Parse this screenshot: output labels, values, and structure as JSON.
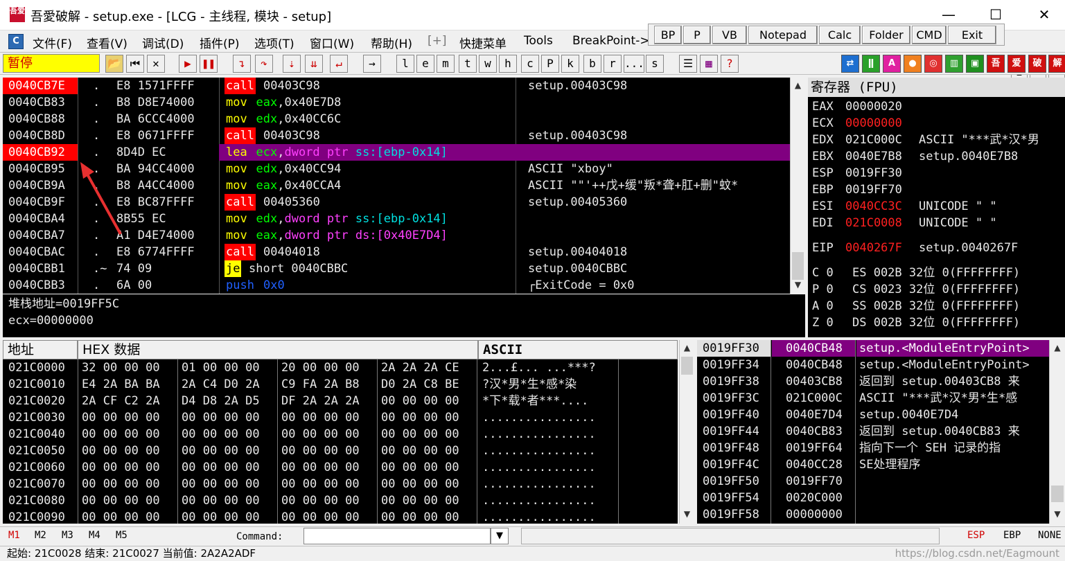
{
  "window": {
    "title": "吾愛破解 - setup.exe - [LCG - 主线程, 模块 - setup]",
    "icon": "吾爱",
    "minimize": "—",
    "maximize": "☐",
    "close": "✕"
  },
  "menu": {
    "items": [
      "文件(F)",
      "查看(V)",
      "调试(D)",
      "插件(P)",
      "选项(T)",
      "窗口(W)",
      "帮助(H)",
      "[+]",
      "快捷菜单",
      "Tools",
      "BreakPoint->"
    ]
  },
  "plugin_bar": {
    "buttons": [
      "BP",
      "P",
      "VB",
      "Notepad",
      "Calc",
      "Folder",
      "CMD",
      "Exit"
    ]
  },
  "toolbar": {
    "status": "暂停",
    "letters": [
      "l",
      "e",
      "m",
      "t",
      "w",
      "h",
      "c",
      "P",
      "k",
      "b",
      "r",
      "...",
      "s"
    ]
  },
  "disasm": {
    "rows": [
      {
        "addr": "0040CB7E",
        "mark": ".",
        "hex": "E8 1571FFFF",
        "op": "call",
        "args": "00403C98",
        "comment": "setup.00403C98",
        "addr_hl": true
      },
      {
        "addr": "0040CB83",
        "mark": ".",
        "hex": "B8 D8E74000",
        "op": "mov",
        "args": "eax,0x40E7D8",
        "comment": ""
      },
      {
        "addr": "0040CB88",
        "mark": ".",
        "hex": "BA 6CCC4000",
        "op": "mov",
        "args": "edx,0x40CC6C",
        "comment": ""
      },
      {
        "addr": "0040CB8D",
        "mark": ".",
        "hex": "E8 0671FFFF",
        "op": "call",
        "args": "00403C98",
        "comment": "setup.00403C98"
      },
      {
        "addr": "0040CB92",
        "mark": ".",
        "hex": "8D4D EC",
        "op": "lea",
        "args": "ecx,dword ptr ss:[ebp-0x14]",
        "comment": "",
        "addr_hl": true,
        "row_hl": true
      },
      {
        "addr": "0040CB95",
        "mark": ".",
        "hex": "BA 94CC4000",
        "op": "mov",
        "args": "edx,0x40CC94",
        "comment": "ASCII \"xboy\""
      },
      {
        "addr": "0040CB9A",
        "mark": ".",
        "hex": "B8 A4CC4000",
        "op": "mov",
        "args": "eax,0x40CCA4",
        "comment": "ASCII \"\"'++戊+缓\"叛*聋+肛+删\"蚊*"
      },
      {
        "addr": "0040CB9F",
        "mark": ".",
        "hex": "E8 BC87FFFF",
        "op": "call",
        "args": "00405360",
        "comment": "setup.00405360"
      },
      {
        "addr": "0040CBA4",
        "mark": ".",
        "hex": "8B55 EC",
        "op": "mov",
        "args": "edx,dword ptr ss:[ebp-0x14]",
        "comment": ""
      },
      {
        "addr": "0040CBA7",
        "mark": ".",
        "hex": "A1 D4E74000",
        "op": "mov",
        "args": "eax,dword ptr ds:[0x40E7D4]",
        "comment": ""
      },
      {
        "addr": "0040CBAC",
        "mark": ".",
        "hex": "E8 6774FFFF",
        "op": "call",
        "args": "00404018",
        "comment": "setup.00404018"
      },
      {
        "addr": "0040CBB1",
        "mark": ".~",
        "hex": "74 09",
        "op": "je",
        "args": "short 0040CBBC",
        "comment": "setup.0040CBBC"
      },
      {
        "addr": "0040CBB3",
        "mark": ".",
        "hex": "6A 00",
        "op": "push",
        "args": "0x0",
        "comment": "┌ExitCode = 0x0"
      }
    ]
  },
  "info": {
    "line1": "堆栈地址=0019FF5C",
    "line2": "ecx=00000000"
  },
  "registers": {
    "title": "寄存器 (FPU)",
    "rows": [
      {
        "name": "EAX",
        "value": "00000020",
        "desc": "",
        "red": false
      },
      {
        "name": "ECX",
        "value": "00000000",
        "desc": "",
        "red": true
      },
      {
        "name": "EDX",
        "value": "021C000C",
        "desc": "ASCII \"***武*汉*男",
        "red": false
      },
      {
        "name": "EBX",
        "value": "0040E7B8",
        "desc": "setup.0040E7B8",
        "red": false
      },
      {
        "name": "ESP",
        "value": "0019FF30",
        "desc": "",
        "red": false
      },
      {
        "name": "EBP",
        "value": "0019FF70",
        "desc": "",
        "red": false
      },
      {
        "name": "ESI",
        "value": "0040CC3C",
        "desc": "UNICODE \" \"",
        "red": true
      },
      {
        "name": "EDI",
        "value": "021C0008",
        "desc": "UNICODE \" \"",
        "red": true
      }
    ],
    "eip": {
      "name": "EIP",
      "value": "0040267F",
      "desc": "setup.0040267F"
    },
    "flags": [
      {
        "f": "C 0",
        "seg": "ES 002B 32位 0(FFFFFFFF)"
      },
      {
        "f": "P 0",
        "seg": "CS 0023 32位 0(FFFFFFFF)"
      },
      {
        "f": "A 0",
        "seg": "SS 002B 32位 0(FFFFFFFF)"
      },
      {
        "f": "Z 0",
        "seg": "DS 002B 32位 0(FFFFFFFF)"
      }
    ]
  },
  "dump": {
    "addr_header": "地址",
    "hex_header": "HEX 数据",
    "ascii_header": "ASCII",
    "rows": [
      {
        "addr": "021C0000",
        "hex": "32 00 00 00 01 00 00 00 20 00 00 00 2A 2A 2A CE",
        "ascii": "2...£... ...***?"
      },
      {
        "addr": "021C0010",
        "hex": "E4 2A BA BA 2A C4 D0 2A C9 FA 2A B8 D0 2A C8 BE",
        "ascii": "?汉*男*生*感*染"
      },
      {
        "addr": "021C0020",
        "hex": "2A CF C2 2A D4 D8 2A D5 DF 2A 2A 2A 00 00 00 00",
        "ascii": "*下*载*者***...."
      },
      {
        "addr": "021C0030",
        "hex": "00 00 00 00 00 00 00 00 00 00 00 00 00 00 00 00",
        "ascii": "................"
      },
      {
        "addr": "021C0040",
        "hex": "00 00 00 00 00 00 00 00 00 00 00 00 00 00 00 00",
        "ascii": "................"
      },
      {
        "addr": "021C0050",
        "hex": "00 00 00 00 00 00 00 00 00 00 00 00 00 00 00 00",
        "ascii": "................"
      },
      {
        "addr": "021C0060",
        "hex": "00 00 00 00 00 00 00 00 00 00 00 00 00 00 00 00",
        "ascii": "................"
      },
      {
        "addr": "021C0070",
        "hex": "00 00 00 00 00 00 00 00 00 00 00 00 00 00 00 00",
        "ascii": "................"
      },
      {
        "addr": "021C0080",
        "hex": "00 00 00 00 00 00 00 00 00 00 00 00 00 00 00 00",
        "ascii": "................"
      },
      {
        "addr": "021C0090",
        "hex": "00 00 00 00 00 00 00 00 00 00 00 00 00 00 00 00",
        "ascii": "................"
      }
    ]
  },
  "stack": {
    "rows": [
      {
        "addr": "0019FF30",
        "val": "0040CB48",
        "comment": "setup.<ModuleEntryPoint>",
        "hl": true
      },
      {
        "addr": "0019FF34",
        "val": "0040CB48",
        "comment": "setup.<ModuleEntryPoint>"
      },
      {
        "addr": "0019FF38",
        "val": "00403CB8",
        "comment": "返回到 setup.00403CB8 来"
      },
      {
        "addr": "0019FF3C",
        "val": "021C000C",
        "comment": "ASCII \"***武*汉*男*生*感"
      },
      {
        "addr": "0019FF40",
        "val": "0040E7D4",
        "comment": "setup.0040E7D4"
      },
      {
        "addr": "0019FF44",
        "val": "0040CB83",
        "comment": "返回到 setup.0040CB83 来"
      },
      {
        "addr": "0019FF48",
        "val": "0019FF64",
        "comment": "指向下一个 SEH 记录的指"
      },
      {
        "addr": "0019FF4C",
        "val": "0040CC28",
        "comment": "SE处理程序"
      },
      {
        "addr": "0019FF50",
        "val": "0019FF70",
        "comment": ""
      },
      {
        "addr": "0019FF54",
        "val": "0020C000",
        "comment": ""
      },
      {
        "addr": "0019FF58",
        "val": "00000000",
        "comment": ""
      }
    ]
  },
  "bottom": {
    "tabs": [
      "M1",
      "M2",
      "M3",
      "M4",
      "M5"
    ],
    "command_label": "Command:",
    "command_value": "",
    "esp": "ESP",
    "ebp": "EBP",
    "none": "NONE"
  },
  "status": {
    "text": "起始: 21C0028 结束: 21C0027 当前值: 2A2A2ADF",
    "watermark": "https://blog.csdn.net/Eagmount"
  },
  "colors": {
    "red_hl": "#ff0000",
    "purple_hl": "#800080",
    "pause_bg": "#ffff00"
  }
}
